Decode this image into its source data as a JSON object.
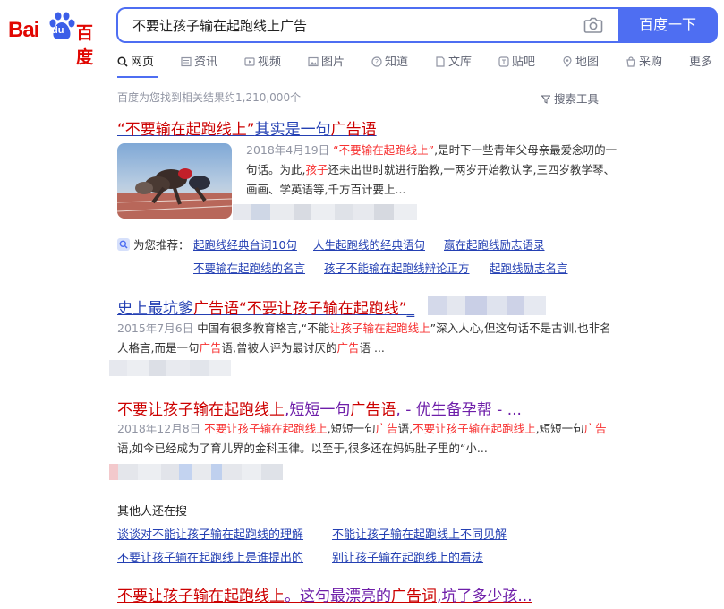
{
  "logo": {
    "text_latin": "Bai",
    "paw_text": "du",
    "text_cn": "百度"
  },
  "search": {
    "query": "不要让孩子输在起跑线上广告",
    "button_label": "百度一下"
  },
  "tabs": [
    {
      "label": "网页",
      "icon": "search-icon",
      "active": true
    },
    {
      "label": "资讯",
      "icon": "news-icon"
    },
    {
      "label": "视频",
      "icon": "video-icon"
    },
    {
      "label": "图片",
      "icon": "image-icon"
    },
    {
      "label": "知道",
      "icon": "question-icon"
    },
    {
      "label": "文库",
      "icon": "document-icon"
    },
    {
      "label": "贴吧",
      "icon": "tieba-icon"
    },
    {
      "label": "地图",
      "icon": "map-icon"
    },
    {
      "label": "采购",
      "icon": "shopping-icon"
    },
    {
      "label": "更多",
      "icon": ""
    }
  ],
  "result_count": "百度为您找到相关结果约1,210,000个",
  "tools_label": "搜索工具",
  "results": [
    {
      "title_parts": [
        "“不要输在起跑线上”",
        "其实是一句",
        "广告语"
      ],
      "date": "2018年4月19日",
      "snippet_parts": [
        "“不要输在起跑线上”",
        ",是时下一些青年父母亲最爱念叨的一句话。为此,",
        "孩子",
        "还未出世时就进行胎教,一两岁开始教认字,三四岁教学琴、画画、学英语等,千方百计要上..."
      ],
      "recommend_label": "为您推荐：",
      "recommendations": [
        "起跑线经典台词10句",
        "人生起跑线的经典语句",
        "赢在起跑线励志语录",
        "不要输在起跑线的名言",
        "孩子不能输在起跑线辩论正方",
        "起跑线励志名言"
      ]
    },
    {
      "title_parts": [
        "史上最坑爹",
        "广告语",
        "“不要让孩子输在起跑线”",
        "_"
      ],
      "date": "2015年7月6日",
      "snippet_parts": [
        "中国有很多教育格言,“不能",
        "让孩子输在起跑线上",
        "”深入人心,但这句话不是古训,也非名人格言,而是一句",
        "广告",
        "语,曾被人评为最讨厌的",
        "广告",
        "语 ..."
      ]
    },
    {
      "title_parts": [
        "不要让孩子输在起跑线上",
        ",短短一句",
        "广告语",
        ", - 优生备孕帮 - ..."
      ],
      "date": "2018年12月8日",
      "snippet_parts": [
        "不要让孩子输在起跑线上",
        ",短短一句",
        "广告",
        "语,",
        "不要让孩子输在起跑线上",
        ",短短一句",
        "广告",
        "语,如今已经成为了育儿界的金科玉律。以至于,很多还在妈妈肚子里的“小..."
      ]
    }
  ],
  "others": {
    "title": "其他人还在搜",
    "links": [
      "谈谈对不能让孩子输在起跑线的理解",
      "不能让孩子输在起跑线上不同见解",
      "不要让孩子输在起跑线上是谁提出的",
      "别让孩子输在起跑线上的看法"
    ]
  },
  "bottom_result": {
    "title_parts": [
      "不要让孩子输在起跑线上",
      "。这句最漂亮的",
      "广告词",
      ",坑了多少孩..."
    ]
  },
  "colors": {
    "brand": "#4e6ef2",
    "title_blue": "#2440b3",
    "highlight_red": "#f73131",
    "visited_purple": "#6e1ea9"
  }
}
